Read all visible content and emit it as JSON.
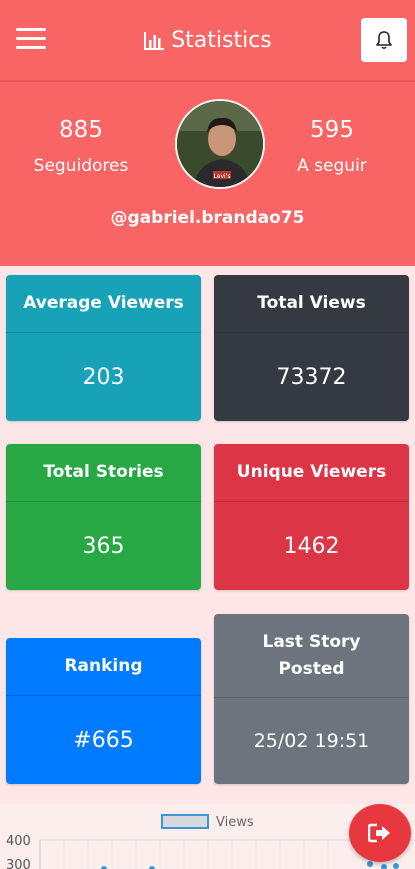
{
  "header": {
    "title": "Statistics",
    "menu_icon": "hamburger-icon",
    "bell_icon": "bell-icon"
  },
  "profile": {
    "followers_count": "885",
    "followers_label": "Seguidores",
    "following_count": "595",
    "following_label": "A seguir",
    "username": "@gabriel.brandao75"
  },
  "cards": [
    {
      "title": "Average Viewers",
      "value": "203",
      "color": "#17a2b8"
    },
    {
      "title": "Total Views",
      "value": "73372",
      "color": "#343a40"
    },
    {
      "title": "Total Stories",
      "value": "365",
      "color": "#28a745"
    },
    {
      "title": "Unique Viewers",
      "value": "1462",
      "color": "#dc3545"
    },
    {
      "title": "Ranking",
      "value": "#665",
      "color": "#007bff"
    },
    {
      "title": "Last Story Posted",
      "value": "25/02 19:51",
      "color": "#6c757d"
    }
  ],
  "chart": {
    "legend": "Views",
    "ticks": [
      "400",
      "300"
    ]
  },
  "chart_data": {
    "type": "line",
    "series": [
      {
        "name": "Views",
        "values": []
      }
    ],
    "ylabel": "",
    "xlabel": "",
    "yticks": [
      400,
      300
    ]
  },
  "fab": {
    "icon": "logout-icon"
  }
}
